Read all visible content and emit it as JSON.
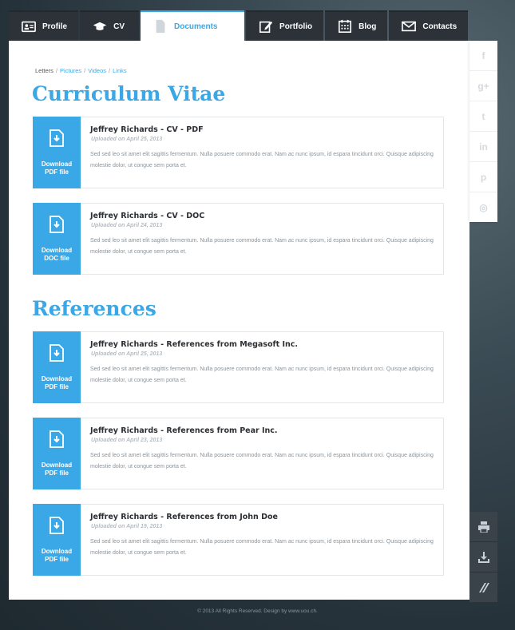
{
  "tabs": [
    {
      "label": "Profile",
      "icon": "profile-card-icon"
    },
    {
      "label": "CV",
      "icon": "graduation-cap-icon"
    },
    {
      "label": "Documents",
      "icon": "document-icon",
      "active": true
    },
    {
      "label": "Portfolio",
      "icon": "pencil-edit-icon"
    },
    {
      "label": "Blog",
      "icon": "calendar-icon"
    },
    {
      "label": "Contacts",
      "icon": "envelope-icon"
    }
  ],
  "breadcrumb": {
    "current": "Letters",
    "links": [
      "Pictures",
      "Videos",
      "Links"
    ],
    "separator": "/"
  },
  "sections": {
    "cv_title": "Curriculum Vitae",
    "references_title": "References"
  },
  "documents": [
    {
      "title": "Jeffrey Richards - CV - PDF",
      "date": "Uploaded on April 25, 2013",
      "button": [
        "Download",
        "PDF file"
      ],
      "desc": "Sed sed leo sit amet elit sagittis fermentum. Nulla posuere commodo erat. Nam ac nunc ipsum, id espara tincidunt orci. Quisque adipiscing molestie dolor, ut congue sem porta et."
    },
    {
      "title": "Jeffrey Richards - CV - DOC",
      "date": "Uploaded on April 24, 2013",
      "button": [
        "Download",
        "DOC file"
      ],
      "desc": "Sed sed leo sit amet elit sagittis fermentum. Nulla posuere commodo erat. Nam ac nunc ipsum, id espara tincidunt orci. Quisque adipiscing molestie dolor, ut congue sem porta et."
    },
    {
      "title": "Jeffrey Richards - References from Megasoft Inc.",
      "date": "Uploaded on April 25, 2013",
      "button": [
        "Download",
        "PDF file"
      ],
      "desc": "Sed sed leo sit amet elit sagittis fermentum. Nulla posuere commodo erat. Nam ac nunc ipsum, id espara tincidunt orci. Quisque adipiscing molestie dolor, ut congue sem porta et."
    },
    {
      "title": "Jeffrey Richards - References from Pear Inc.",
      "date": "Uploaded on April 23, 2013",
      "button": [
        "Download",
        "PDF file"
      ],
      "desc": "Sed sed leo sit amet elit sagittis fermentum. Nulla posuere commodo erat. Nam ac nunc ipsum, id espara tincidunt orci. Quisque adipiscing molestie dolor, ut congue sem porta et."
    },
    {
      "title": "Jeffrey Richards - References from John Doe",
      "date": "Uploaded on April 19, 2013",
      "button": [
        "Download",
        "PDF file"
      ],
      "desc": "Sed sed leo sit amet elit sagittis fermentum. Nulla posuere commodo erat. Nam ac nunc ipsum, id espara tincidunt orci. Quisque adipiscing molestie dolor, ut congue sem porta et."
    }
  ],
  "social": [
    {
      "glyph": "f",
      "icon": "facebook-icon"
    },
    {
      "glyph": "g+",
      "icon": "google-plus-icon"
    },
    {
      "glyph": "t",
      "icon": "twitter-icon"
    },
    {
      "glyph": "in",
      "icon": "linkedin-icon"
    },
    {
      "glyph": "p",
      "icon": "pinterest-icon"
    },
    {
      "glyph": "◎",
      "icon": "dribbble-icon"
    }
  ],
  "tools": [
    {
      "icon": "print-icon"
    },
    {
      "icon": "download-icon"
    },
    {
      "icon": "resize-handle-icon"
    }
  ],
  "footer": "© 2013 All Rights Reserved. Design by www.uou.ch.",
  "colors": {
    "accent": "#3aa8e6",
    "tab_bg": "#2c3238",
    "text_dark": "#2b2f33",
    "text_muted": "#8a949c"
  }
}
